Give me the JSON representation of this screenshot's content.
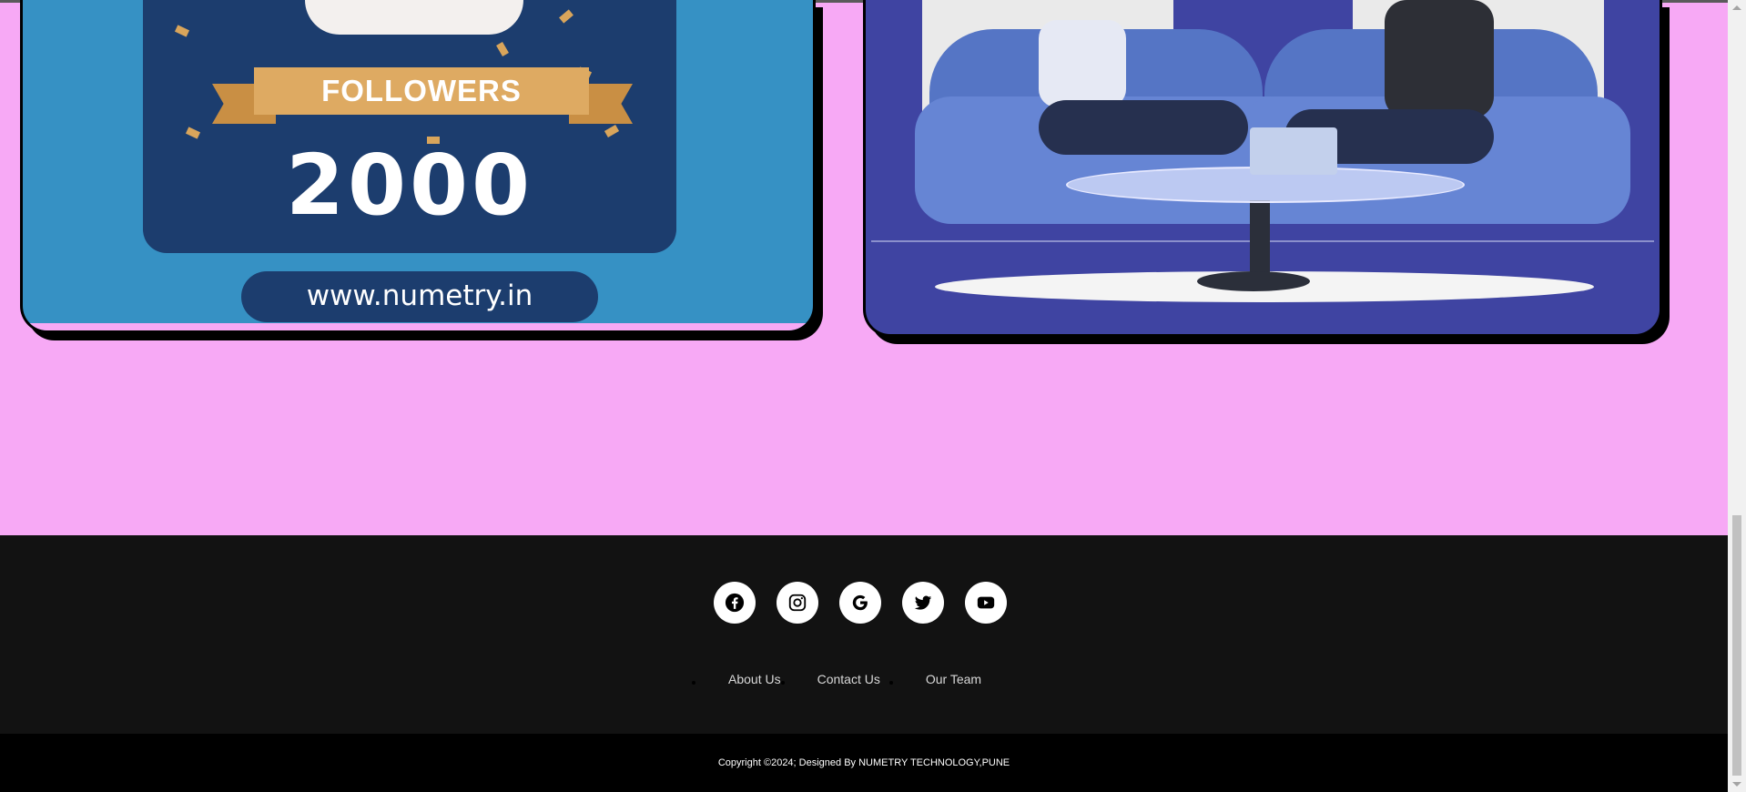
{
  "promo_card": {
    "ribbon_text": "FOLLOWERS",
    "count_text": "2000",
    "url_text": "www.numetry.in"
  },
  "illustration": {
    "icon": "office-meeting-illustration"
  },
  "footer": {
    "social": [
      {
        "name": "facebook",
        "icon": "facebook-icon"
      },
      {
        "name": "instagram",
        "icon": "instagram-icon"
      },
      {
        "name": "google",
        "icon": "google-icon"
      },
      {
        "name": "twitter",
        "icon": "twitter-icon"
      },
      {
        "name": "youtube",
        "icon": "youtube-icon"
      }
    ],
    "links": [
      "About Us",
      "Contact Us",
      "Our Team"
    ],
    "copyright": "Copyright ©2024; Designed By NUMETRY TECHNOLOGY,PUNE"
  },
  "colors": {
    "page_background": "#f7a9f5",
    "footer_background": "#121212",
    "bottom_bar": "#000000",
    "promo_blue": "#3691c4",
    "illustration_background": "#3f44a2"
  }
}
